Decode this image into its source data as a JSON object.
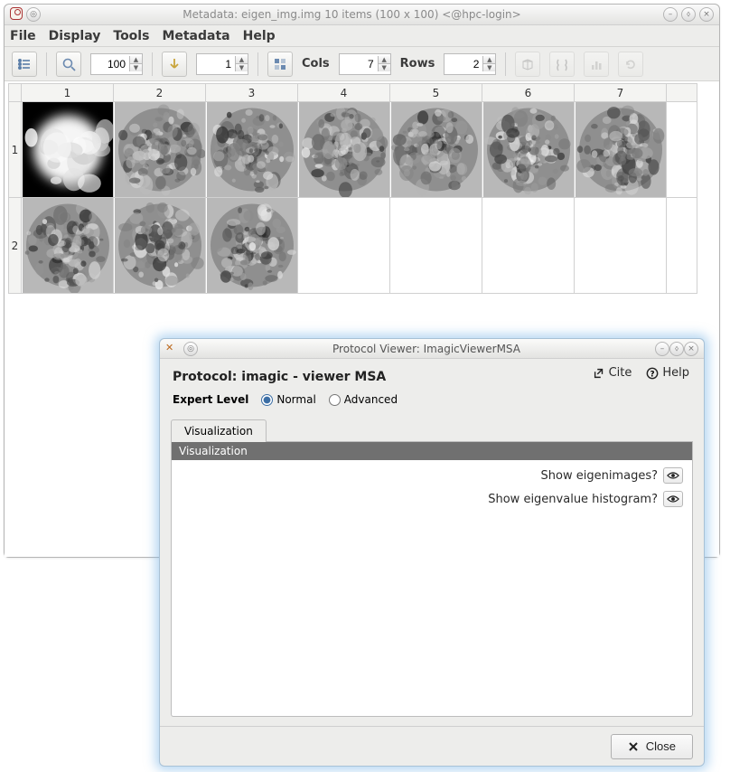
{
  "main": {
    "title": "Metadata: eigen_img.img 10 items (100 x 100) <@hpc-login>",
    "menu": {
      "file": "File",
      "display": "Display",
      "tools": "Tools",
      "metadata": "Metadata",
      "help": "Help"
    },
    "toolbar": {
      "zoom": "100",
      "goto": "1",
      "cols_label": "Cols",
      "cols": "7",
      "rows_label": "Rows",
      "rows": "2"
    },
    "grid": {
      "col_headers": [
        "1",
        "2",
        "3",
        "4",
        "5",
        "6",
        "7"
      ],
      "row_headers": [
        "1",
        "2"
      ]
    }
  },
  "dialog": {
    "title": "Protocol Viewer: ImagicViewerMSA",
    "heading": "Protocol: imagic - viewer MSA",
    "cite": "Cite",
    "help": "Help",
    "expert_label": "Expert Level",
    "rb_normal": "Normal",
    "rb_adv": "Advanced",
    "tab": "Visualization",
    "section": "Visualization",
    "row1": "Show eigenimages?",
    "row2": "Show eigenvalue histogram?",
    "close": "Close"
  }
}
